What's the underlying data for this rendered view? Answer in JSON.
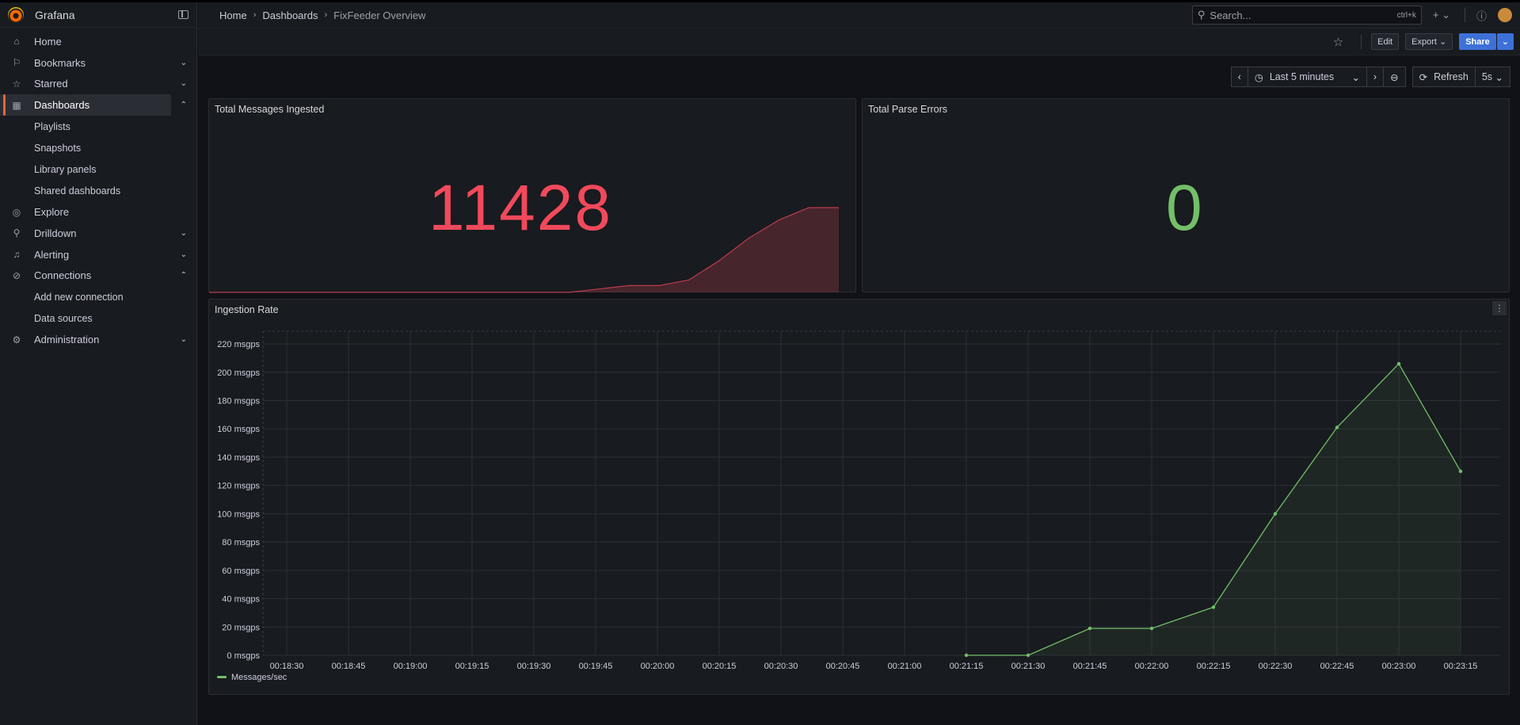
{
  "app": {
    "name": "Grafana"
  },
  "sidebar": {
    "items": [
      {
        "label": "Home",
        "icon": "home-icon",
        "chev": ""
      },
      {
        "label": "Bookmarks",
        "icon": "bookmark-icon",
        "chev": "⌄"
      },
      {
        "label": "Starred",
        "icon": "star-icon",
        "chev": "⌄"
      },
      {
        "label": "Dashboards",
        "icon": "dashboards-icon",
        "chev": "⌃",
        "active": true
      },
      {
        "label": "Playlists",
        "sub": true
      },
      {
        "label": "Snapshots",
        "sub": true
      },
      {
        "label": "Library panels",
        "sub": true
      },
      {
        "label": "Shared dashboards",
        "sub": true
      },
      {
        "label": "Explore",
        "icon": "compass-icon",
        "chev": ""
      },
      {
        "label": "Drilldown",
        "icon": "microscope-icon",
        "chev": "⌄"
      },
      {
        "label": "Alerting",
        "icon": "bell-icon",
        "chev": "⌄"
      },
      {
        "label": "Connections",
        "icon": "link-icon",
        "chev": "⌃"
      },
      {
        "label": "Add new connection",
        "sub": true
      },
      {
        "label": "Data sources",
        "sub": true
      },
      {
        "label": "Administration",
        "icon": "gear-icon",
        "chev": "⌄"
      }
    ]
  },
  "breadcrumb": {
    "home": "Home",
    "dashboards": "Dashboards",
    "current": "FixFeeder Overview"
  },
  "search": {
    "placeholder": "Search...",
    "shortcut": "ctrl+k"
  },
  "toolbar": {
    "edit": "Edit",
    "export": "Export",
    "share": "Share"
  },
  "time": {
    "range": "Last 5 minutes",
    "refresh": "Refresh",
    "interval": "5s"
  },
  "panels": {
    "total_messages": {
      "title": "Total Messages Ingested",
      "value": "11428",
      "color": "#f2495c"
    },
    "parse_errors": {
      "title": "Total Parse Errors",
      "value": "0",
      "color": "#73bf69"
    },
    "ingestion_rate": {
      "title": "Ingestion Rate"
    }
  },
  "chart_data": [
    {
      "type": "area",
      "title": "Total Messages Ingested",
      "sparkline": true,
      "values": [
        0,
        0,
        0,
        0,
        0,
        0,
        0,
        0,
        0,
        0,
        0,
        0,
        0,
        300,
        600,
        600,
        1100,
        2800,
        4800,
        6400,
        7500,
        7500
      ]
    },
    {
      "type": "line",
      "title": "Ingestion Rate",
      "x": [
        "00:21:15",
        "00:21:30",
        "00:21:45",
        "00:22:00",
        "00:22:15",
        "00:22:30",
        "00:22:45",
        "00:23:00",
        "00:23:15"
      ],
      "series": [
        {
          "name": "Messages/sec",
          "values": [
            0,
            0,
            19,
            19,
            34,
            100,
            161,
            206,
            130
          ],
          "color": "#73bf69"
        }
      ],
      "xticks": [
        "00:18:30",
        "00:18:45",
        "00:19:00",
        "00:19:15",
        "00:19:30",
        "00:19:45",
        "00:20:00",
        "00:20:15",
        "00:20:30",
        "00:20:45",
        "00:21:00",
        "00:21:15",
        "00:21:30",
        "00:21:45",
        "00:22:00",
        "00:22:15",
        "00:22:30",
        "00:22:45",
        "00:23:00",
        "00:23:15"
      ],
      "yticks": [
        "0 msgps",
        "20 msgps",
        "40 msgps",
        "60 msgps",
        "80 msgps",
        "100 msgps",
        "120 msgps",
        "140 msgps",
        "160 msgps",
        "180 msgps",
        "200 msgps",
        "220 msgps"
      ],
      "ylim": [
        0,
        220
      ],
      "grid": true,
      "legend": "bottom-left"
    }
  ]
}
